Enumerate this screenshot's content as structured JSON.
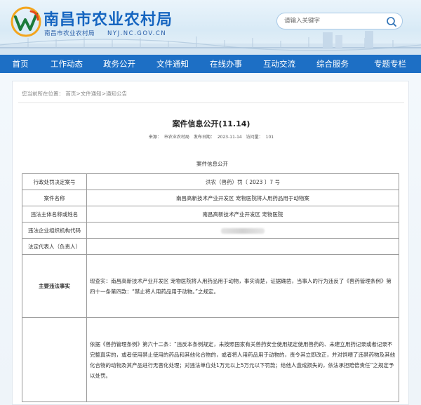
{
  "site": {
    "title": "南昌市农业农村局",
    "subtitle": "南昌市农业农村局",
    "domain": "NYJ.NC.GOV.CN"
  },
  "search": {
    "placeholder": "请输入关键字"
  },
  "nav": [
    {
      "label": "首页"
    },
    {
      "label": "工作动态"
    },
    {
      "label": "政务公开"
    },
    {
      "label": "文件通知"
    },
    {
      "label": "在线办事"
    },
    {
      "label": "互动交流"
    },
    {
      "label": "综合服务"
    },
    {
      "label": "专题专栏"
    }
  ],
  "breadcrumb": {
    "prefix": "您当前所在位置：",
    "home": "首页",
    "sep1": ">",
    "files": "文件通知",
    "sep2": ">",
    "notice": "通知公告"
  },
  "article": {
    "title": "案件信息公开(11.14)",
    "source_label": "来源：",
    "source": "市农业农村局",
    "date_label": "发布日期：",
    "date": "2023-11-14",
    "views_label": "访问量：",
    "views": "101",
    "subheading": "案件信息公开"
  },
  "table": {
    "rows": [
      {
        "key": "行政处罚决定案号",
        "value": "洪农（兽药）罚〔 2023 〕7 号"
      },
      {
        "key": "案件名称",
        "value": "南昌高新技术产业开发区    宠物医院将人用药品用于动物案"
      },
      {
        "key": "违法主体名称或姓名",
        "value": "南昌高新技术产业开发区    宠物医院"
      },
      {
        "key": "违法企业组织机构代码",
        "value": ""
      },
      {
        "key": "法定代表人（负责人）",
        "value": ""
      }
    ],
    "facts_key": "主要违法事实",
    "facts": "现查实：南昌高新技术产业开发区    宠物医院将人用药品用于动物，事实清楚，证据确凿，当事人的行为违反了《兽药管理条例》第四十一条第四款：“禁止将人用药品用于动物。”之规定。",
    "basis": "依据《兽药管理条例》第六十二条：“违反本条例规定，未按照国家有关兽药安全使用规定使用兽药的、未建立用药记录或者记录不完整真实的，或者使用禁止使用的药品和其他化合物的，或者将人用药品用于动物的，责令其立即改正，并对饲喂了违禁药物及其他化合物的动物及其产品进行无害化处理；对违法单位处1万元以上5万元以下罚款；给他人造成损失的，依法承担赔偿责任”之规定予以处罚。"
  }
}
